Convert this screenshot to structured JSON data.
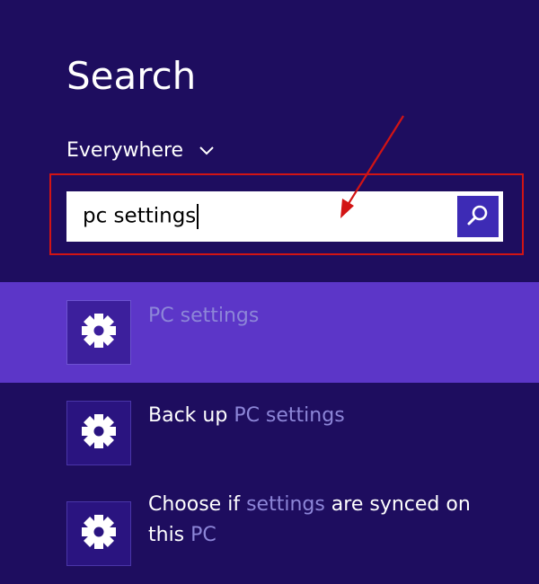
{
  "header": {
    "title": "Search",
    "scope_label": "Everywhere"
  },
  "search": {
    "value": "pc settings"
  },
  "results": [
    {
      "icon": "gear-icon",
      "parts": [
        {
          "text": "PC settings",
          "highlight": true
        }
      ],
      "selected": true
    },
    {
      "icon": "gear-icon",
      "parts": [
        {
          "text": "Back up ",
          "highlight": false
        },
        {
          "text": "PC settings",
          "highlight": true
        }
      ],
      "selected": false
    },
    {
      "icon": "gear-icon",
      "parts": [
        {
          "text": "Choose if ",
          "highlight": false
        },
        {
          "text": "settings",
          "highlight": true
        },
        {
          "text": " are synced on",
          "highlight": false
        },
        {
          "text": "\n",
          "highlight": false
        },
        {
          "text": "this ",
          "highlight": false
        },
        {
          "text": "PC",
          "highlight": true
        }
      ],
      "selected": false
    }
  ],
  "colors": {
    "background": "#1e0d5f",
    "selected_row": "#5c36c8",
    "match_highlight": "#8d86d8",
    "annotation_red": "#d21414",
    "search_button": "#3d2bb5"
  }
}
